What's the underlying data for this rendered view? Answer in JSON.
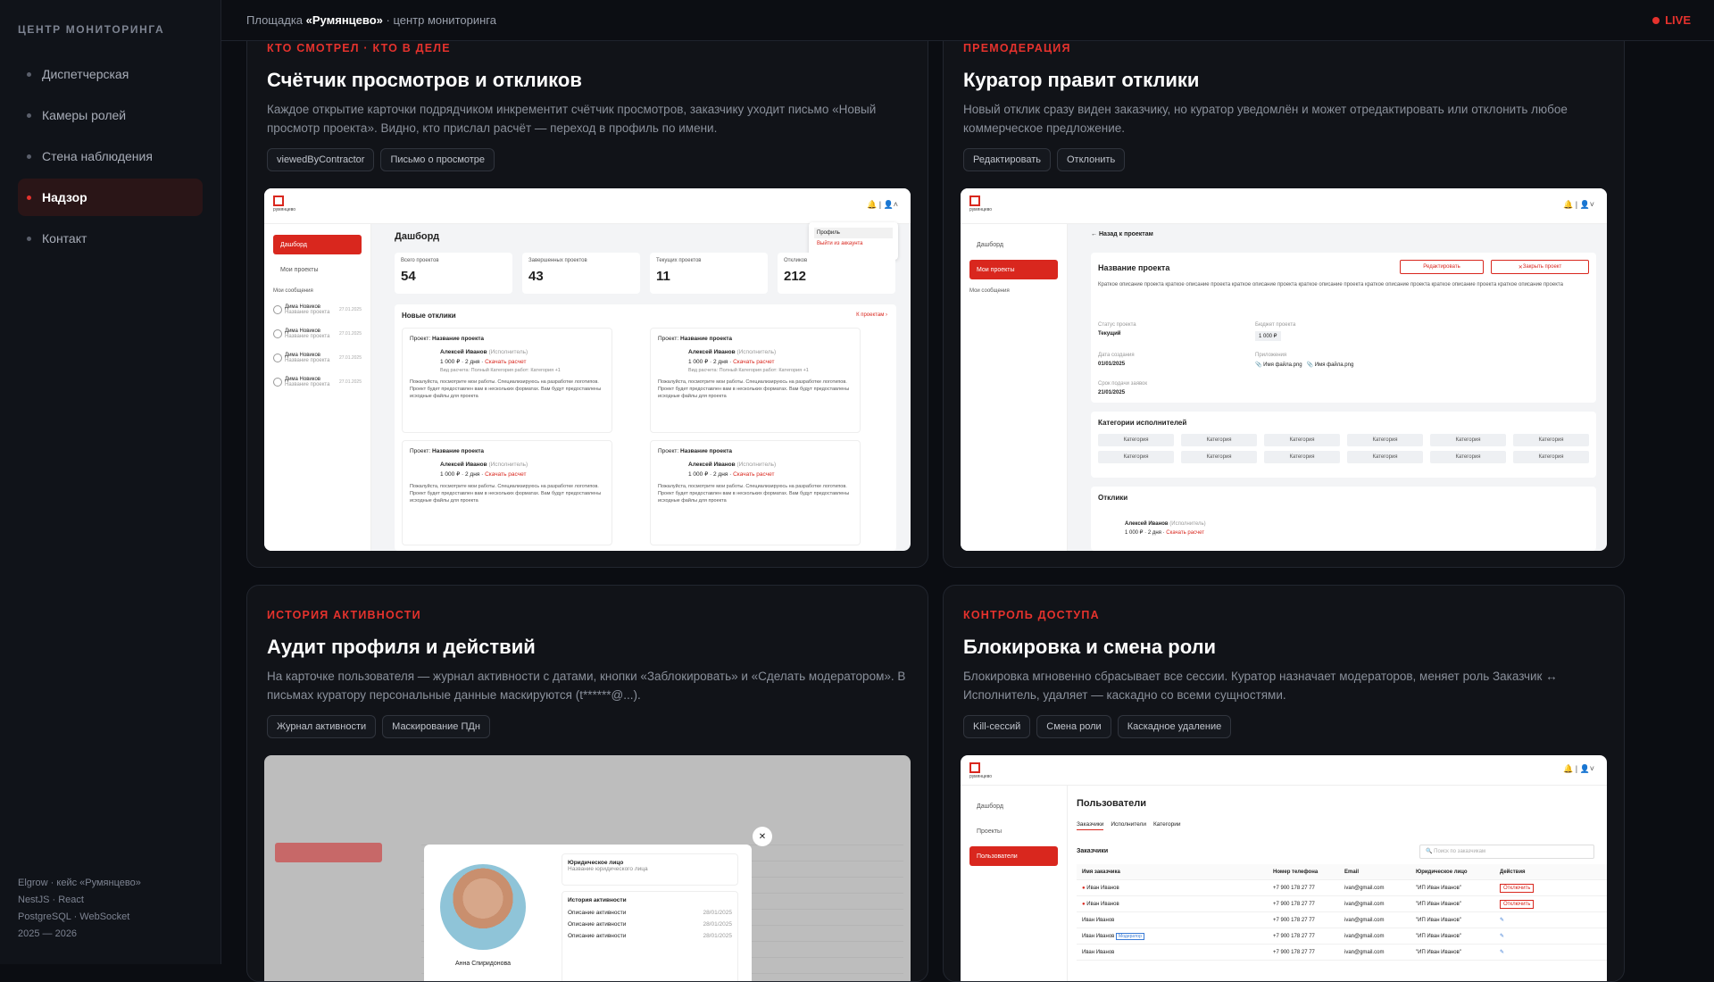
{
  "sidebar": {
    "title": "ЦЕНТР МОНИТОРИНГА",
    "items": [
      {
        "label": "Диспетчерская"
      },
      {
        "label": "Камеры ролей"
      },
      {
        "label": "Стена наблюдения"
      },
      {
        "label": "Надзор"
      },
      {
        "label": "Контакт"
      }
    ],
    "active_index": 3,
    "footer": [
      "Elgrow · кейс «Румянцево»",
      "NestJS · React",
      "PostgreSQL · WebSocket",
      "2025 — 2026"
    ]
  },
  "topbar": {
    "crumb_prefix": "Площадка",
    "crumb_name": "«Румянцево»",
    "crumb_suffix": "· центр мониторинга",
    "live": "LIVE"
  },
  "cards": [
    {
      "kicker": "КТО СМОТРЕЛ · КТО В ДЕЛЕ",
      "title": "Счётчик просмотров и откликов",
      "desc": "Каждое открытие карточки подрядчиком инкрементит счётчик просмотров, заказчику уходит письмо «Новый просмотр проекта». Видно, кто прислал расчёт — переход в профиль по имени.",
      "tags": [
        "viewedByContractor",
        "Письмо о просмотре"
      ]
    },
    {
      "kicker": "ПРЕМОДЕРАЦИЯ",
      "title": "Куратор правит отклики",
      "desc": "Новый отклик сразу виден заказчику, но куратор уведомлён и может отредактировать или отклонить любое коммерческое предложение.",
      "tags": [
        "Редактировать",
        "Отклонить"
      ]
    },
    {
      "kicker": "ИСТОРИЯ АКТИВНОСТИ",
      "title": "Аудит профиля и действий",
      "desc": "На карточке пользователя — журнал активности с датами, кнопки «Заблокировать» и «Сделать модератором». В письмах куратору персональные данные маскируются (t******@...).",
      "tags": [
        "Журнал активности",
        "Маскирование ПДн"
      ]
    },
    {
      "kicker": "КОНТРОЛЬ ДОСТУПА",
      "title": "Блокировка и смена роли",
      "desc": "Блокировка мгновенно сбрасывает все сессии. Куратор назначает модераторов, меняет роль Заказчик ↔ Исполнитель, удаляет — каскадно со всеми сущностями.",
      "tags": [
        "Kill-сессий",
        "Смена роли",
        "Каскадное удаление"
      ]
    }
  ],
  "shot1": {
    "logo": "румянцево",
    "nav": [
      "Дашборд",
      "Мои проекты"
    ],
    "messages_title": "Мои сообщения",
    "messages": [
      {
        "name": "Дима Новиков",
        "sub": "Название проекта",
        "date": "27.01.2025",
        "badge": "1"
      },
      {
        "name": "Дима Новиков",
        "sub": "Название проекта",
        "date": "27.01.2025",
        "badge": "1"
      },
      {
        "name": "Дима Новиков",
        "sub": "Название проекта",
        "date": "27.01.2025",
        "badge": ""
      },
      {
        "name": "Дима Новиков",
        "sub": "Название проекта",
        "date": "27.01.2025",
        "badge": ""
      }
    ],
    "page_title": "Дашборд",
    "stats": [
      {
        "label": "Всего проектов",
        "value": "54"
      },
      {
        "label": "Завершенных проектов",
        "value": "43"
      },
      {
        "label": "Текущих проектов",
        "value": "11"
      },
      {
        "label": "Откликов",
        "value": "212"
      }
    ],
    "menu": [
      "Профиль",
      "Выйти из аккаунта"
    ],
    "new_responses": "Новые отклики",
    "to_projects": "К проектам",
    "response": {
      "project_prefix": "Проект:",
      "project_name": "Название проекта",
      "author": "Алексей Иванов",
      "role": "(Исполнитель)",
      "price": "1 000 ₽",
      "days": "2 дня",
      "download": "Скачать расчет",
      "work_type_label": "Вид расчета:",
      "work_type": "Полный",
      "cat_label": "Категория работ:",
      "cat": "Категория",
      "more": "+1",
      "text": "Пожалуйста, посмотрите мои работы. Специализируюсь на разработке логотипов. Проект будет предоставлен вам в нескольких форматах. Вам будут предоставлены исходные файлы для проекта"
    }
  },
  "shot2": {
    "logo": "румянцево",
    "nav": [
      "Дашборд",
      "Мои проекты"
    ],
    "messages_title": "Мои сообщения",
    "back": "Назад к проектам",
    "project_title": "Название проекта",
    "edit": "Редактировать",
    "close": "Закрыть проект",
    "short_desc": "Краткое описание проекта краткое описание проекта краткое описание проекта краткое описание проекта краткое описание проекта краткое описание проекта краткое описание проекта",
    "status_label": "Статус проекта",
    "status": "Текущий",
    "budget_label": "Бюджет проекта",
    "budget": "1 000 ₽",
    "created_label": "Дата создания",
    "created": "01/01/2025",
    "attach_label": "Приложения",
    "attach1": "Имя файла.png",
    "attach2": "Имя файла.png",
    "deadline_label": "Срок подачи заявок",
    "deadline": "21/01/2025",
    "categories_title": "Категории исполнителей",
    "category": "Категория",
    "responses_title": "Отклики",
    "author": "Алексей Иванов",
    "role": "(Исполнитель)",
    "price": "1 000 ₽",
    "days": "2 дня",
    "download": "Скачать расчет"
  },
  "shot3": {
    "modal_person": "Анна Спиридонова",
    "legal_title": "Юридическое лицо",
    "legal_sub": "Название юридического лица",
    "history_title": "История активности",
    "history": [
      {
        "label": "Описание активности",
        "date": "28/01/2025"
      },
      {
        "label": "Описание активности",
        "date": "28/01/2025"
      },
      {
        "label": "Описание активности",
        "date": "28/01/2025"
      }
    ],
    "close_glyph": "✕"
  },
  "shot4": {
    "logo": "румянцево",
    "nav": [
      "Дашборд",
      "Проекты",
      "Пользователи"
    ],
    "title": "Пользователи",
    "tabs": [
      "Заказчики",
      "Исполнители",
      "Категории"
    ],
    "section": "Заказчики",
    "search_placeholder": "Поиск по заказчикам",
    "columns": [
      "Имя заказчика",
      "Номер телефона",
      "Email",
      "Юридическое лицо",
      "Действия"
    ],
    "rows": [
      {
        "name": "Иван Иванов",
        "phone": "+7 900 178 27 77",
        "email": "ivan@gmail.com",
        "legal": "\"ИП Иван Иванов\"",
        "blocked": true
      },
      {
        "name": "Иван Иванов",
        "phone": "+7 900 178 27 77",
        "email": "ivan@gmail.com",
        "legal": "\"ИП Иван Иванов\"",
        "blocked": true
      },
      {
        "name": "Иван Иванов",
        "phone": "+7 900 178 27 77",
        "email": "ivan@gmail.com",
        "legal": "\"ИП Иван Иванов\"",
        "blocked": false
      },
      {
        "name": "Иван Иванов",
        "phone": "+7 900 178 27 77",
        "email": "ivan@gmail.com",
        "legal": "\"ИП Иван Иванов\"",
        "blocked": false,
        "badge": "Модератор"
      },
      {
        "name": "Иван Иванов",
        "phone": "+7 900 178 27 77",
        "email": "ivan@gmail.com",
        "legal": "\"ИП Иван Иванов\"",
        "blocked": false
      }
    ],
    "unblock": "Отключить"
  },
  "colors": {
    "accent": "#e5322d",
    "bg": "#0b0d12",
    "card": "#111318"
  }
}
